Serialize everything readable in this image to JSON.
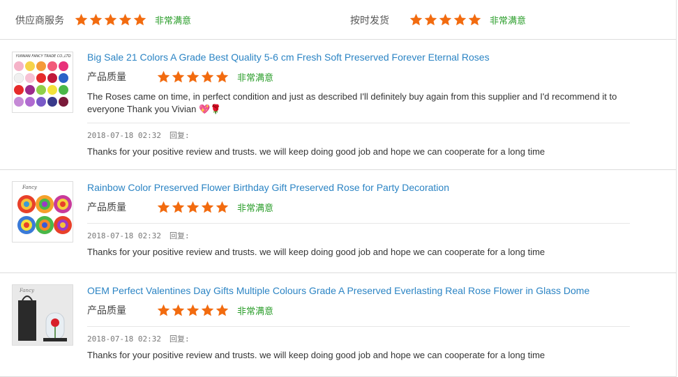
{
  "summary": {
    "supplier_service": {
      "label": "供应商服务",
      "stars": 5,
      "verdict": "非常满意"
    },
    "on_time_delivery": {
      "label": "按时发货",
      "stars": 5,
      "verdict": "非常满意"
    }
  },
  "colors": {
    "star": "#f26b0f",
    "verdict": "#2a9d2a",
    "link": "#2b84c4"
  },
  "reviews": [
    {
      "title": "Big Sale 21 Colors A Grade Best Quality 5-6 cm Fresh Soft Preserved Forever Eternal Roses",
      "rating_label": "产品质量",
      "stars": 5,
      "verdict": "非常满意",
      "comment": "The Roses came on time, in perfect condition and just as described I'll definitely buy again from this supplier and I'd recommend it to everyone Thank you Vivian 💖🌹",
      "date": "2018-07-18 02:32",
      "reply_label": "回复:",
      "reply": "Thanks for your positive review and trusts. we will keep doing good job and hope we can cooperate for a long time"
    },
    {
      "title": "Rainbow Color Preserved Flower Birthday Gift Preserved Rose for Party Decoration",
      "rating_label": "产品质量",
      "stars": 5,
      "verdict": "非常满意",
      "comment": "",
      "date": "2018-07-18 02:32",
      "reply_label": "回复:",
      "reply": "Thanks for your positive review and trusts. we will keep doing good job and hope we can cooperate for a long time"
    },
    {
      "title": "OEM Perfect Valentines Day Gifts Multiple Colours Grade A Preserved Everlasting Real Rose Flower in Glass Dome",
      "rating_label": "产品质量",
      "stars": 5,
      "verdict": "非常满意",
      "comment": "",
      "date": "2018-07-18 02:32",
      "reply_label": "回复:",
      "reply": "Thanks for your positive review and trusts. we will keep doing good job and hope we can cooperate for a long time"
    }
  ],
  "thumbnails": {
    "roses_grid_header": "YUNNAN FANCY TRADE CO.,LTD",
    "rainbow_logo": "Fancy",
    "dome_logo": "Fancy"
  },
  "icons": {
    "star": "star-icon"
  }
}
